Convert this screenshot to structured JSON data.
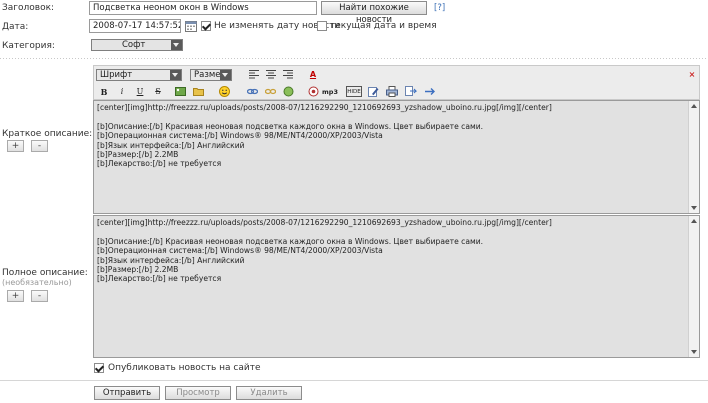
{
  "form": {
    "title_label": "Заголовок:",
    "title_value": "Подсветка неоном окон в Windows",
    "find_similar_label": "Найти похожие новости",
    "help_link": "[?]",
    "date_label": "Дата:",
    "date_value": "2008-07-17 14:57:52",
    "keep_date_label": "Не изменять дату новости",
    "keep_date_checked": true,
    "current_date_label": "текущая дата и время",
    "current_date_checked": false,
    "category_label": "Категория:",
    "category_value": "Софт"
  },
  "toolbar": {
    "font_select": "Шрифт",
    "size_select": "Размер",
    "bold": "B",
    "italic": "i",
    "underline": "U",
    "strike": "S",
    "mp3": "mp3",
    "hide": "HIDE",
    "close": "×"
  },
  "short_desc": {
    "label": "Краткое описание:",
    "lines": [
      "[center][img]http://freezzz.ru/uploads/posts/2008-07/1216292290_1210692693_yzshadow_uboino.ru.jpg[/img][/center]",
      "",
      "[b]Описание:[/b] Красивая неоновая подсветка каждого окна в Windows. Цвет выбираете сами.",
      "[b]Операционная система:[/b] Windows® 98/ME/NT4/2000/XP/2003/Vista",
      "[b]Язык интерфейса:[/b] Английский",
      "[b]Размер:[/b] 2.2MB",
      "[b]Лекарство:[/b] не требуется"
    ]
  },
  "full_desc": {
    "label": "Полное описание:",
    "optional": "(необязательно)",
    "lines": [
      "[center][img]http://freezzz.ru/uploads/posts/2008-07/1216292290_1210692693_yzshadow_uboino.ru.jpg[/img][/center]",
      "",
      "[b]Описание:[/b] Красивая неоновая подсветка каждого окна в Windows. Цвет выбираете сами.",
      "[b]Операционная система:[/b] Windows® 98/ME/NT4/2000/XP/2003/Vista",
      "[b]Язык интерфейса:[/b] Английский",
      "[b]Размер:[/b] 2.2MB",
      "[b]Лекарство:[/b] не требуется"
    ]
  },
  "controls": {
    "plus": "+",
    "minus": "-"
  },
  "publish": {
    "label": "Опубликовать новость на сайте",
    "checked": true
  },
  "actions": {
    "submit": "Отправить",
    "preview": "Просмотр",
    "delete": "Удалить"
  },
  "colors": {
    "link": "#3b6fb6",
    "editor_bg": "#e1e1e1",
    "close_red": "#cc2222",
    "text_color_red": "#c00000"
  }
}
